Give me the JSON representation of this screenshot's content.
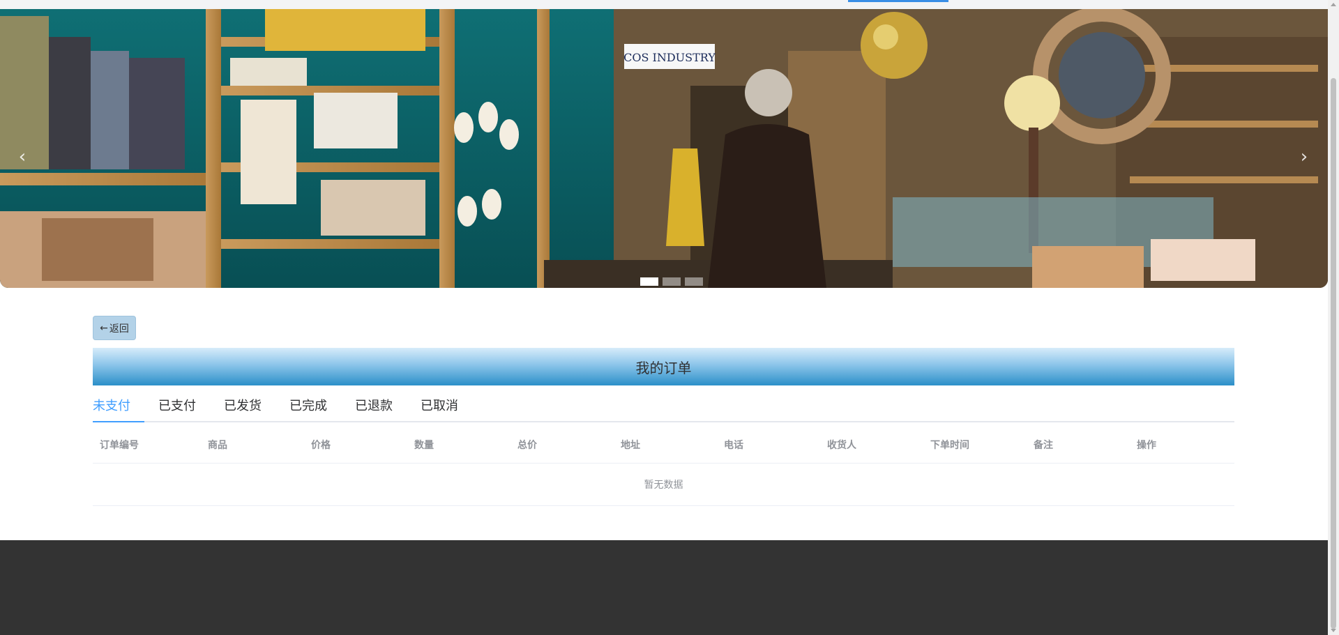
{
  "banner": {
    "prev_arrow": "‹",
    "next_arrow": "›",
    "shop_sign": "COS INDUSTRY",
    "indicator_count": 3,
    "active_indicator": 0
  },
  "back_button": {
    "icon": "←",
    "label": "返回"
  },
  "page_title": "我的订单",
  "tabs": [
    {
      "label": "未支付",
      "active": true
    },
    {
      "label": "已支付",
      "active": false
    },
    {
      "label": "已发货",
      "active": false
    },
    {
      "label": "已完成",
      "active": false
    },
    {
      "label": "已退款",
      "active": false
    },
    {
      "label": "已取消",
      "active": false
    }
  ],
  "table": {
    "columns": [
      "订单编号",
      "商品",
      "价格",
      "数量",
      "总价",
      "地址",
      "电话",
      "收货人",
      "下单时间",
      "备注",
      "操作"
    ],
    "empty_text": "暂无数据"
  },
  "colors": {
    "accent": "#409eff",
    "title_bar_bottom": "#2b8fc8",
    "footer": "#333333"
  }
}
